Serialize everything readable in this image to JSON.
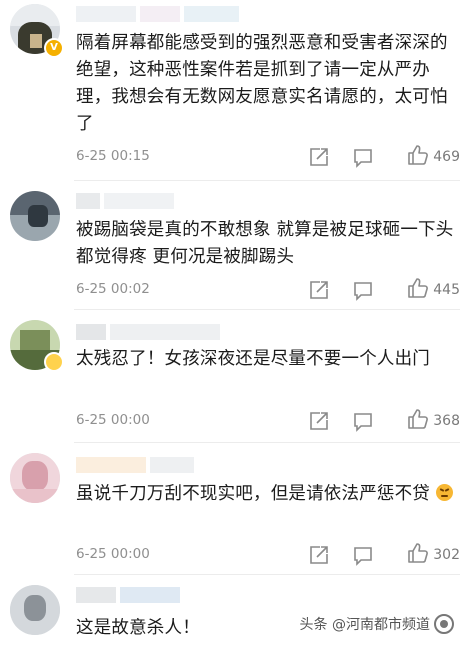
{
  "comments": [
    {
      "text": "隔着屏幕都能感受到的强烈恶意和受害者深深的绝望，这种恶性案件若是抓到了请一定从严办理，我想会有无数网友愿意实名请愿的，太可怕了",
      "time": "6-25 00:15",
      "likes": "469",
      "verified": true
    },
    {
      "text": "被踢脑袋是真的不敢想象 就算是被足球砸一下头都觉得疼 更何况是被脚踢头",
      "time": "6-25 00:02",
      "likes": "445"
    },
    {
      "text": "太残忍了！女孩深夜还是尽量不要一个人出门",
      "time": "6-25 00:00",
      "likes": "368"
    },
    {
      "text": "虽说千刀万刮不现实吧，但是请依法严惩不贷",
      "emoji": "angry-emoji",
      "time": "6-25 00:00",
      "likes": "302"
    },
    {
      "text": "这是故意杀人！"
    }
  ],
  "icons": {
    "share": "share-icon",
    "comment": "comment-icon",
    "like": "thumbs-up-icon"
  },
  "watermark": {
    "text": "头条 @河南都市频道"
  }
}
